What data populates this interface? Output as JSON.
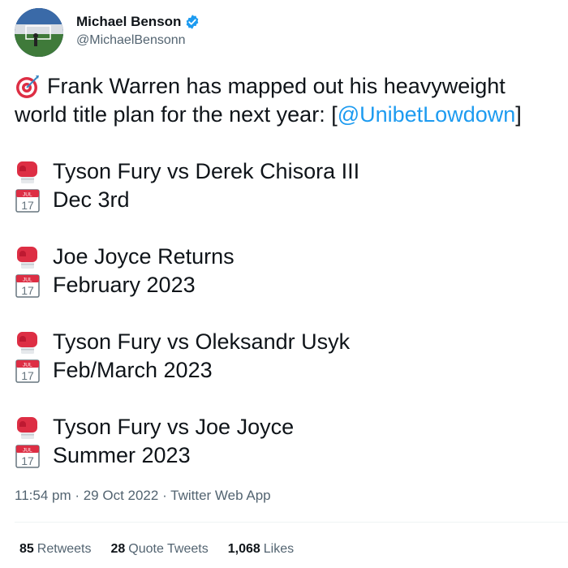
{
  "author": {
    "display_name": "Michael Benson",
    "handle": "@MichaelBensonn",
    "avatar_icon": "avatar-photo-icon",
    "verified_icon": "verified-badge-icon",
    "verified_color": "#1d9bf0"
  },
  "tweet": {
    "intro_emoji": "direct-hit-target-icon",
    "intro_line1": "Frank Warren has mapped out his heavyweight",
    "intro_line2_before": "world title plan for the next year: [",
    "intro_mention": "@UnibetLowdown",
    "intro_line2_after": "]",
    "fights": [
      {
        "title": "Tyson Fury vs Derek Chisora III",
        "date": "Dec 3rd"
      },
      {
        "title": "Joe Joyce Returns",
        "date": "February 2023"
      },
      {
        "title": "Tyson Fury vs Oleksandr Usyk",
        "date": "Feb/March 2023"
      },
      {
        "title": "Tyson Fury vs Joe Joyce",
        "date": "Summer 2023"
      }
    ],
    "fight_icon": "boxing-glove-icon",
    "date_icon": "calendar-icon",
    "calendar_month": "JUL",
    "calendar_day": "17"
  },
  "meta": {
    "text": "11:54 pm · 29 Oct 2022 · Twitter Web App"
  },
  "stats": {
    "retweets_count": "85",
    "retweets_label": "Retweets",
    "quotes_count": "28",
    "quotes_label": "Quote Tweets",
    "likes_count": "1,068",
    "likes_label": "Likes"
  },
  "colors": {
    "text": "#0f1419",
    "secondary": "#536471",
    "link": "#1d9bf0"
  }
}
